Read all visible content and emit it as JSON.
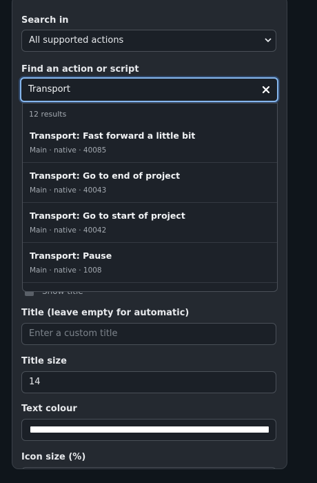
{
  "search_in": {
    "label": "Search in",
    "selected": "All supported actions"
  },
  "find": {
    "label": "Find an action or script",
    "value": "Transport"
  },
  "results": {
    "count_label": "12 results",
    "items": [
      {
        "title": "Transport: Fast forward a little bit",
        "meta": "Main · native · 40085"
      },
      {
        "title": "Transport: Go to end of project",
        "meta": "Main · native · 40043"
      },
      {
        "title": "Transport: Go to start of project",
        "meta": "Main · native · 40042"
      },
      {
        "title": "Transport: Pause",
        "meta": "Main · native · 1008"
      }
    ]
  },
  "show_title": {
    "label": "Show title"
  },
  "title_field": {
    "label": "Title (leave empty for automatic)",
    "placeholder": "Enter a custom title"
  },
  "title_size": {
    "label": "Title size",
    "value": "14"
  },
  "text_colour": {
    "label": "Text colour",
    "color": "#ffffff"
  },
  "icon_size": {
    "label": "Icon size (%)"
  },
  "colors": {
    "focus_ring": "#86b7ee",
    "panel": "#242930",
    "page": "#0f151b"
  }
}
